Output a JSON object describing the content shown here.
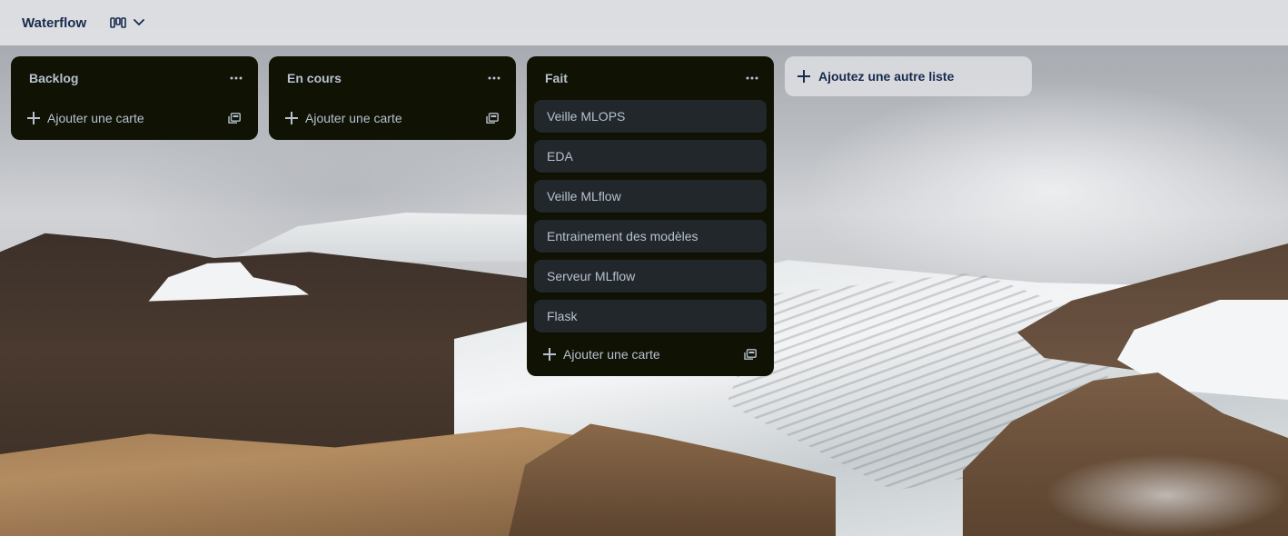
{
  "board": {
    "title": "Waterflow",
    "view_icon": "board-columns-icon",
    "view_chevron": "chevron-down-icon"
  },
  "lists": [
    {
      "title": "Backlog",
      "cards": [],
      "add_card_label": "Ajouter une carte"
    },
    {
      "title": "En cours",
      "cards": [],
      "add_card_label": "Ajouter une carte"
    },
    {
      "title": "Fait",
      "cards": [
        "Veille MLOPS",
        "EDA",
        "Veille MLflow",
        "Entrainement des modèles",
        "Serveur MLflow",
        "Flask"
      ],
      "add_card_label": "Ajouter une carte"
    }
  ],
  "add_list_label": "Ajoutez une autre liste",
  "colors": {
    "list_bg": "#101204",
    "card_bg": "#22272b",
    "text_on_dark": "#b6c2cf",
    "text_dark": "#172b4d"
  }
}
